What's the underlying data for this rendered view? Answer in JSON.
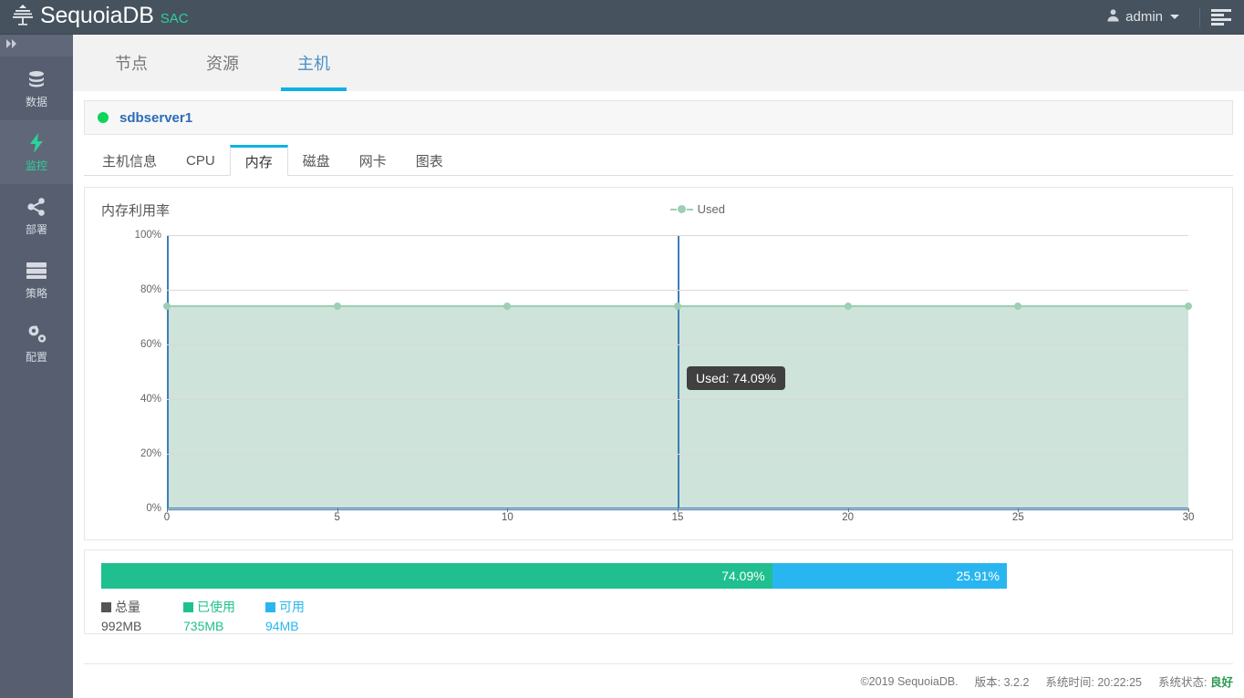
{
  "topbar": {
    "brand": "SequoiaDB",
    "brand_sub": "SAC",
    "logo_icon": "tree-icon",
    "user_name": "admin",
    "user_icon": "user-icon",
    "caret_icon": "chevron-down-icon",
    "menu_icon": "list-menu-icon",
    "bg_color": "#46525e",
    "accent_color": "#2dd09a"
  },
  "sidebar": {
    "toggle_icon": "chevron-double-right-icon",
    "items": [
      {
        "label": "数据",
        "icon": "database-icon",
        "active": false
      },
      {
        "label": "监控",
        "icon": "lightning-bolt-icon",
        "active": true
      },
      {
        "label": "部署",
        "icon": "share-nodes-icon",
        "active": false
      },
      {
        "label": "策略",
        "icon": "server-list-icon",
        "active": false
      },
      {
        "label": "配置",
        "icon": "gears-icon",
        "active": false
      }
    ]
  },
  "main_tabs": [
    {
      "label": "节点",
      "active": false
    },
    {
      "label": "资源",
      "active": false
    },
    {
      "label": "主机",
      "active": true
    }
  ],
  "host_panel": {
    "status_icon": "status-dot-green",
    "status_color": "#0ed459",
    "title": "sdbserver1"
  },
  "sub_tabs": [
    {
      "label": "主机信息",
      "active": false
    },
    {
      "label": "CPU",
      "active": false
    },
    {
      "label": "内存",
      "active": true
    },
    {
      "label": "磁盘",
      "active": false
    },
    {
      "label": "网卡",
      "active": false
    },
    {
      "label": "图表",
      "active": false
    }
  ],
  "chart_data": {
    "type": "area",
    "title": "内存利用率",
    "xlabel": "",
    "ylabel": "",
    "grid": true,
    "legend_position": "top-center",
    "legend": [
      "Used"
    ],
    "series": [
      {
        "name": "Used",
        "color": "#9ccfb4",
        "fill_color": "#cee3d9",
        "x": [
          0,
          5,
          10,
          15,
          20,
          25,
          30
        ],
        "values": [
          74.09,
          74.09,
          74.09,
          74.09,
          74.09,
          74.09,
          74.09
        ]
      }
    ],
    "x": [
      0,
      5,
      10,
      15,
      20,
      25,
      30
    ],
    "xticks": [
      "0",
      "5",
      "10",
      "15",
      "20",
      "25",
      "30"
    ],
    "xlim": [
      0,
      30
    ],
    "yticks": [
      "0%",
      "20%",
      "40%",
      "60%",
      "80%",
      "100%"
    ],
    "ytick_values": [
      0,
      20,
      40,
      60,
      80,
      100
    ],
    "ylim": [
      0,
      100
    ],
    "axis_color": "#3d7eb8",
    "crosshair_x": 15,
    "tooltip": "Used: 74.09%"
  },
  "usage_bar": {
    "used_pct_label": "74.09%",
    "free_pct_label": "25.91%",
    "used_pct": 74.09,
    "free_pct": 25.91,
    "used_color": "#1fbf8f",
    "free_color": "#29b6f0",
    "legend": [
      {
        "label": "总量",
        "value": "992MB",
        "color": "#555555",
        "text_color": "#555555"
      },
      {
        "label": "已使用",
        "value": "735MB",
        "color": "#1fbf8f",
        "text_color": "#1fbf8f"
      },
      {
        "label": "可用",
        "value": "94MB",
        "color": "#29b6f0",
        "text_color": "#29b6f0"
      }
    ]
  },
  "footer": {
    "copyright": "©2019 SequoiaDB.",
    "version_label": "版本: 3.2.2",
    "time_label": "系统时间: 20:22:25",
    "status_prefix": "系统状态:",
    "status_value": "良好"
  }
}
